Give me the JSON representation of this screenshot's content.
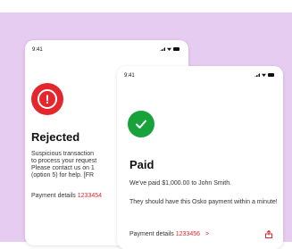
{
  "colors": {
    "accent_red": "#e4262d",
    "success_green": "#18a23b",
    "background_purple": "#e6ccf0"
  },
  "rejected_screen": {
    "time": "9:41",
    "icon": "error-icon",
    "title": "Rejected",
    "body": "Suspicious transaction\nto process your request\nPlease contact us on 1\n(option 5) for help. [FR",
    "payment_label": "Payment details",
    "payment_id": "1233454"
  },
  "paid_screen": {
    "time": "9:41",
    "icon": "check-icon",
    "title": "Paid",
    "body_line1": "We've paid $1,000.00 to John Smith.",
    "body_line2": "They should have this Osko payment within a minute!",
    "payment_label": "Payment details",
    "payment_id": "1233456",
    "chevron": ">",
    "share_icon": "share-icon"
  }
}
